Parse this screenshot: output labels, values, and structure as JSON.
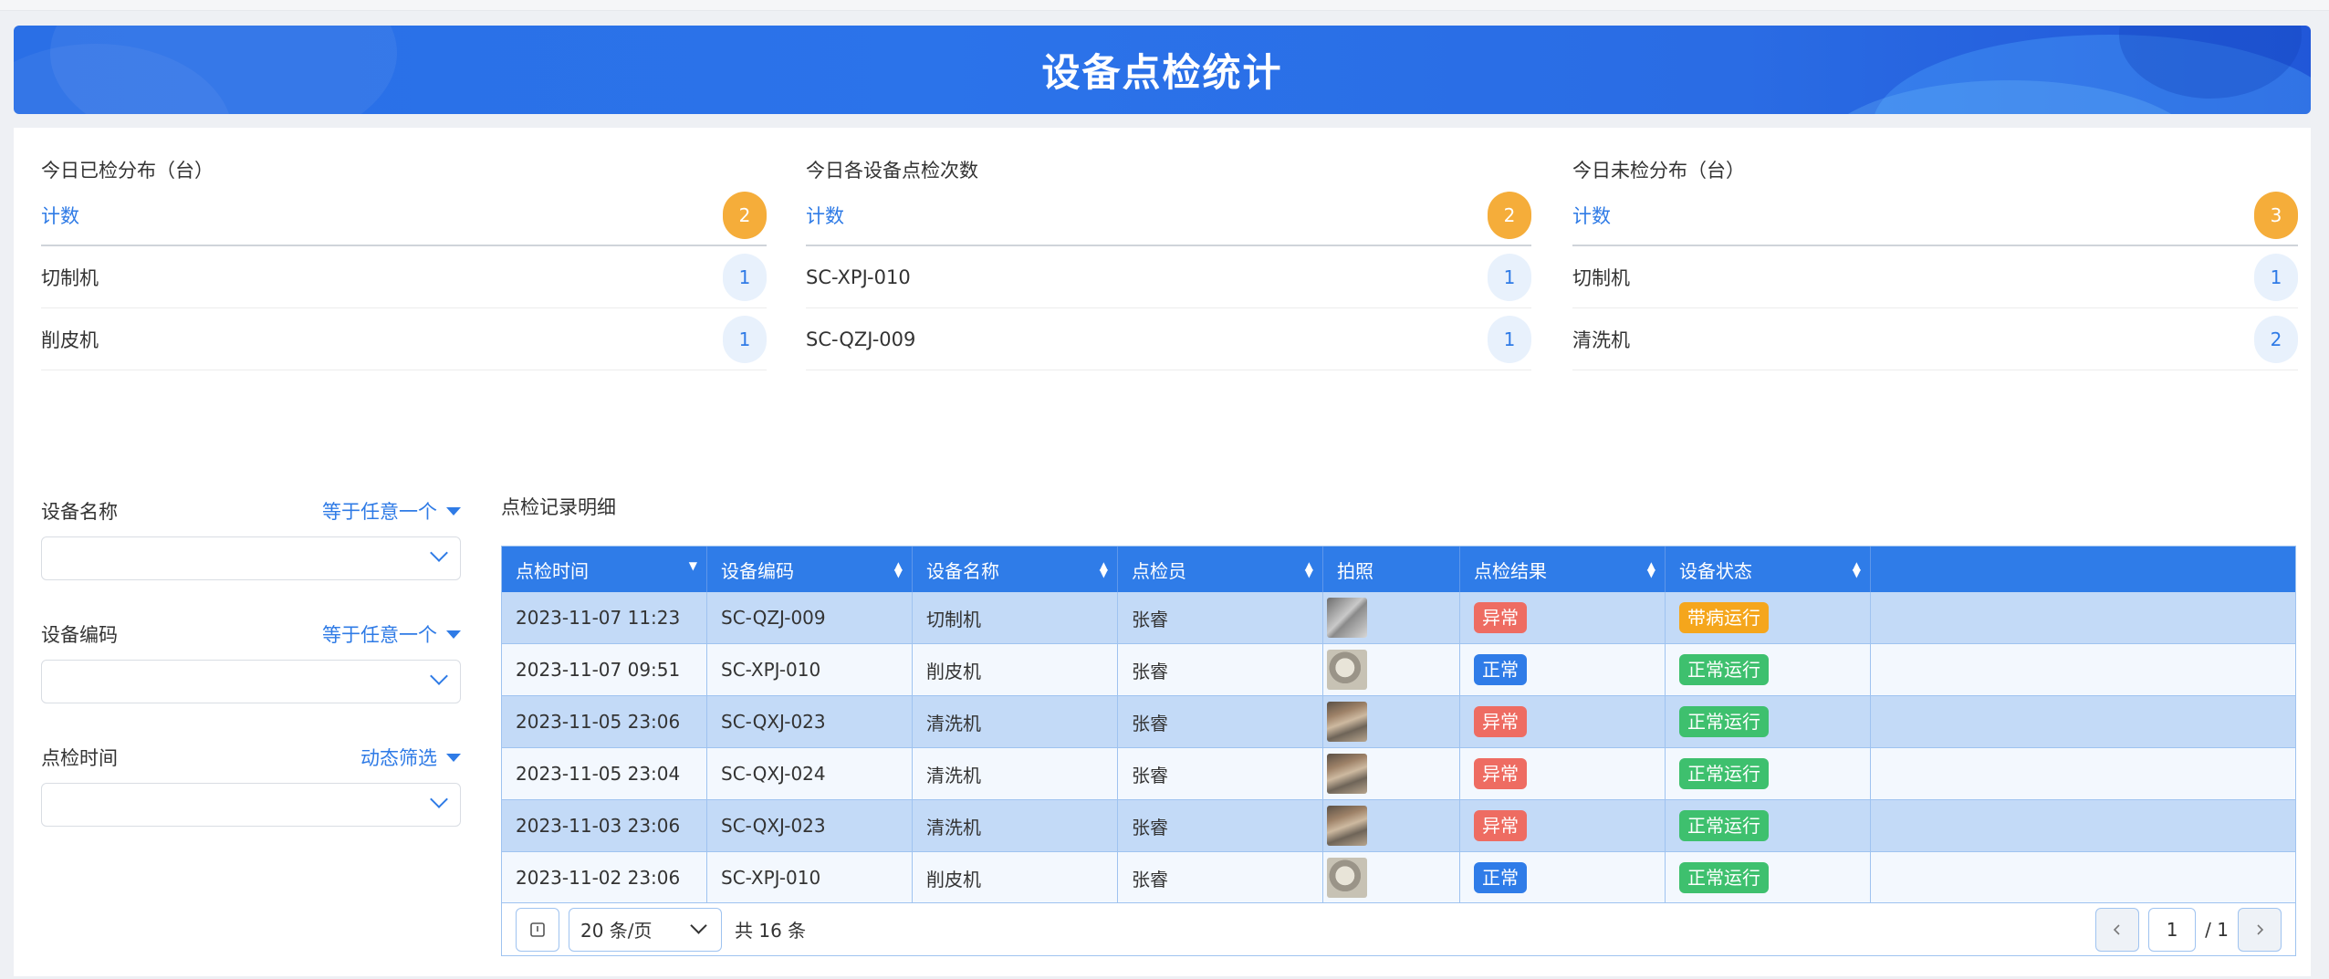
{
  "header": {
    "title": "设备点检统计"
  },
  "stats": [
    {
      "title": "今日已检分布（台）",
      "head_label": "计数",
      "head_value": "2",
      "rows": [
        {
          "label": "切制机",
          "value": "1"
        },
        {
          "label": "削皮机",
          "value": "1"
        }
      ]
    },
    {
      "title": "今日各设备点检次数",
      "head_label": "计数",
      "head_value": "2",
      "rows": [
        {
          "label": "SC-XPJ-010",
          "value": "1"
        },
        {
          "label": "SC-QZJ-009",
          "value": "1"
        }
      ]
    },
    {
      "title": "今日未检分布（台）",
      "head_label": "计数",
      "head_value": "3",
      "rows": [
        {
          "label": "切制机",
          "value": "1"
        },
        {
          "label": "清洗机",
          "value": "2"
        }
      ]
    }
  ],
  "filters": [
    {
      "label": "设备名称",
      "operator": "等于任意一个",
      "value": ""
    },
    {
      "label": "设备编码",
      "operator": "等于任意一个",
      "value": ""
    },
    {
      "label": "点检时间",
      "operator": "动态筛选",
      "value": ""
    }
  ],
  "table": {
    "title": "点检记录明细",
    "columns": [
      "点检时间",
      "设备编码",
      "设备名称",
      "点检员",
      "拍照",
      "点检结果",
      "设备状态"
    ],
    "rows": [
      {
        "time": "2023-11-07 11:23",
        "code": "SC-QZJ-009",
        "name": "切制机",
        "inspector": "张睿",
        "photo": "a",
        "result": "异常",
        "status": "带病运行"
      },
      {
        "time": "2023-11-07 09:51",
        "code": "SC-XPJ-010",
        "name": "削皮机",
        "inspector": "张睿",
        "photo": "b",
        "result": "正常",
        "status": "正常运行"
      },
      {
        "time": "2023-11-05 23:06",
        "code": "SC-QXJ-023",
        "name": "清洗机",
        "inspector": "张睿",
        "photo": "c",
        "result": "异常",
        "status": "正常运行"
      },
      {
        "time": "2023-11-05 23:04",
        "code": "SC-QXJ-024",
        "name": "清洗机",
        "inspector": "张睿",
        "photo": "c",
        "result": "异常",
        "status": "正常运行"
      },
      {
        "time": "2023-11-03 23:06",
        "code": "SC-QXJ-023",
        "name": "清洗机",
        "inspector": "张睿",
        "photo": "c",
        "result": "异常",
        "status": "正常运行"
      },
      {
        "time": "2023-11-02 23:06",
        "code": "SC-XPJ-010",
        "name": "削皮机",
        "inspector": "张睿",
        "photo": "b",
        "result": "正常",
        "status": "正常运行"
      }
    ]
  },
  "pager": {
    "page_size": "20 条/页",
    "total": "共 16 条",
    "current": "1",
    "pages": "/ 1"
  },
  "colors": {
    "accent": "#2f7ce8",
    "abnormal": "#ee6c62",
    "normal": "#2f7ce8",
    "running": "#3ec06e",
    "sick": "#f5a61c",
    "count_badge": "#f5ad3a"
  }
}
